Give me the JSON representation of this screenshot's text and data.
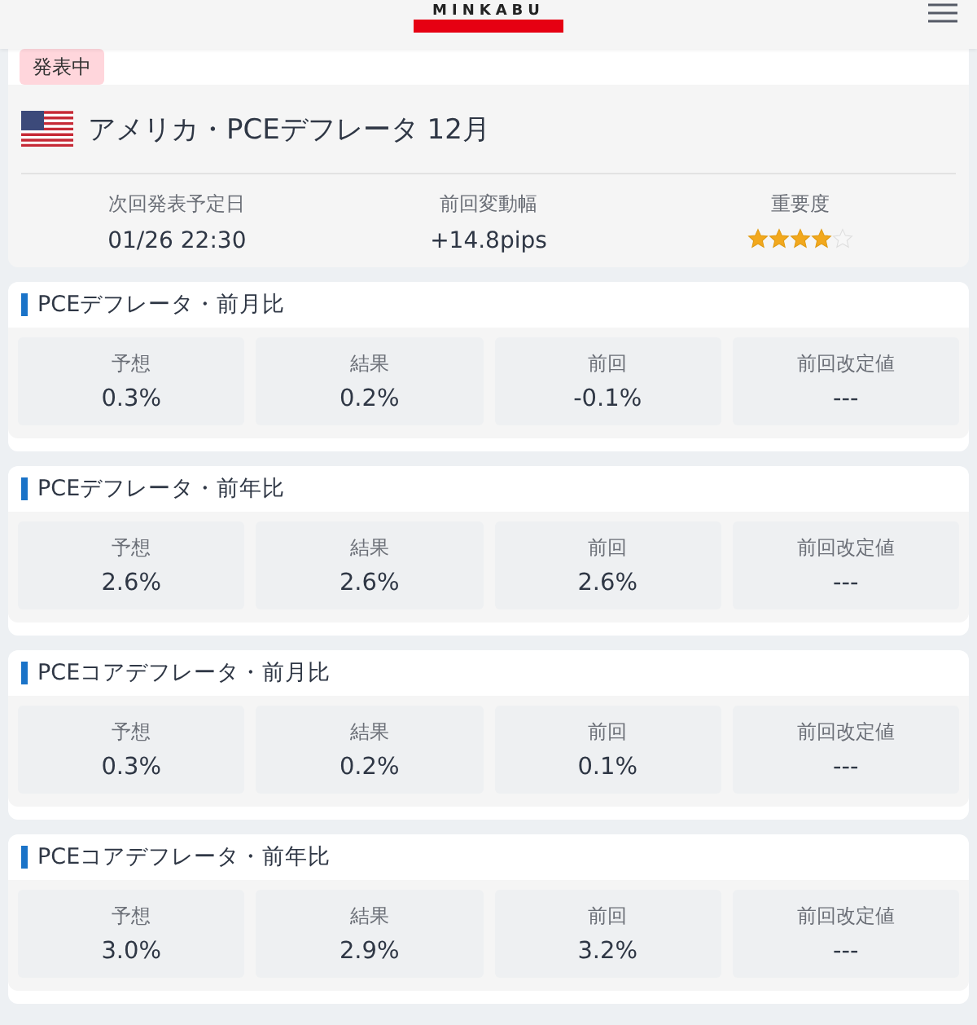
{
  "header": {
    "logo": "MINKABU"
  },
  "event": {
    "status_badge": "発表中",
    "title": "アメリカ・PCEデフレータ 12月",
    "info": [
      {
        "kind": "text",
        "label": "次回発表予定日",
        "value": "01/26 22:30"
      },
      {
        "kind": "text",
        "label": "前回変動幅",
        "value": "+14.8pips"
      },
      {
        "kind": "stars",
        "label": "重要度",
        "stars": 4
      }
    ]
  },
  "sections": [
    {
      "title": "PCEデフレータ・前月比",
      "cells": [
        {
          "label": "予想",
          "value": "0.3%"
        },
        {
          "label": "結果",
          "value": "0.2%"
        },
        {
          "label": "前回",
          "value": "-0.1%"
        },
        {
          "label": "前回改定値",
          "value": "---"
        }
      ]
    },
    {
      "title": "PCEデフレータ・前年比",
      "cells": [
        {
          "label": "予想",
          "value": "2.6%"
        },
        {
          "label": "結果",
          "value": "2.6%"
        },
        {
          "label": "前回",
          "value": "2.6%"
        },
        {
          "label": "前回改定値",
          "value": "---"
        }
      ]
    },
    {
      "title": "PCEコアデフレータ・前月比",
      "cells": [
        {
          "label": "予想",
          "value": "0.3%"
        },
        {
          "label": "結果",
          "value": "0.2%"
        },
        {
          "label": "前回",
          "value": "0.1%"
        },
        {
          "label": "前回改定値",
          "value": "---"
        }
      ]
    },
    {
      "title": "PCEコアデフレータ・前年比",
      "cells": [
        {
          "label": "予想",
          "value": "3.0%"
        },
        {
          "label": "結果",
          "value": "2.9%"
        },
        {
          "label": "前回",
          "value": "3.2%"
        },
        {
          "label": "前回改定値",
          "value": "---"
        }
      ]
    }
  ]
}
